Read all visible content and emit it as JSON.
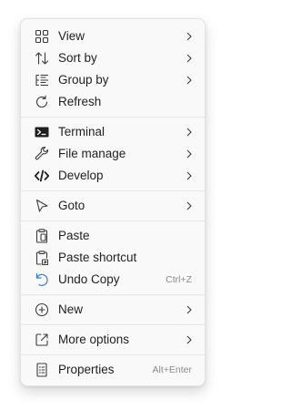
{
  "menu": {
    "view": {
      "label": "View",
      "icon": "grid-icon"
    },
    "sort_by": {
      "label": "Sort by",
      "icon": "sort-icon"
    },
    "group_by": {
      "label": "Group by",
      "icon": "list-icon"
    },
    "refresh": {
      "label": "Refresh",
      "icon": "refresh-icon"
    },
    "terminal": {
      "label": "Terminal",
      "icon": "terminal-icon"
    },
    "file_manage": {
      "label": "File manage",
      "icon": "wrench-icon"
    },
    "develop": {
      "label": "Develop",
      "icon": "code-icon"
    },
    "goto": {
      "label": "Goto",
      "icon": "pointer-icon"
    },
    "paste": {
      "label": "Paste",
      "icon": "clipboard-icon"
    },
    "paste_shortcut": {
      "label": "Paste shortcut",
      "icon": "clipboard-shortcut-icon"
    },
    "undo_copy": {
      "label": "Undo Copy",
      "shortcut": "Ctrl+Z",
      "icon": "undo-icon"
    },
    "new": {
      "label": "New",
      "icon": "add-circle-icon"
    },
    "more_options": {
      "label": "More options",
      "icon": "open-external-icon"
    },
    "properties": {
      "label": "Properties",
      "shortcut": "Alt+Enter",
      "icon": "properties-icon"
    }
  },
  "colors": {
    "text": "#1f1f1f",
    "icon": "#3a3a3a",
    "shortcut": "#8a8a8a",
    "accent": "#2b7fd6"
  }
}
